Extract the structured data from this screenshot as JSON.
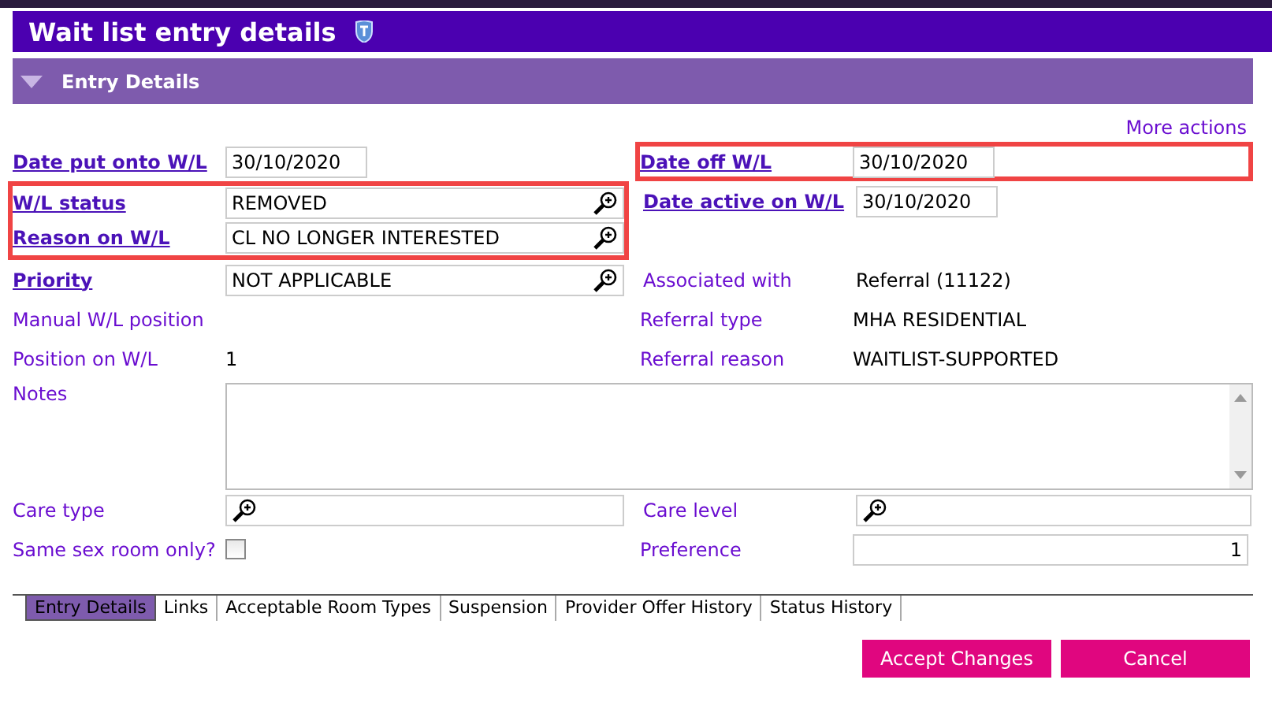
{
  "window": {
    "title": "Wait list entry details"
  },
  "section": {
    "title": "Entry Details",
    "expanded": true
  },
  "more_actions": "More actions",
  "rows": [
    {
      "left": {
        "label": "Date put onto W/L",
        "link": true,
        "kind": "text",
        "value": "30/10/2020",
        "highlighted": false
      },
      "right": {
        "label": "Date off W/L",
        "link": true,
        "kind": "text",
        "value": "30/10/2020",
        "highlighted": true
      }
    },
    {
      "left": {
        "label": "W/L status",
        "link": true,
        "kind": "lookup",
        "value": "REMOVED",
        "highlighted": true
      },
      "right": {
        "label": "Date active on W/L",
        "link": true,
        "kind": "text",
        "value": "30/10/2020",
        "highlighted": false
      }
    },
    {
      "left": {
        "label": "Reason on W/L",
        "link": true,
        "kind": "lookup",
        "value": "CL NO LONGER INTERESTED",
        "highlighted": true
      }
    },
    {
      "left": {
        "label": "Priority",
        "link": true,
        "kind": "lookup",
        "value": "NOT APPLICABLE",
        "highlighted": false
      },
      "right": {
        "label": "Associated with",
        "link": false,
        "kind": "value",
        "value": "Referral (11122)",
        "highlighted": false
      }
    },
    {
      "left": {
        "label": "Manual W/L position",
        "link": false,
        "kind": "value",
        "highlighted": false
      },
      "right": {
        "label": "Referral type",
        "link": false,
        "kind": "value",
        "value": "MHA RESIDENTIAL",
        "highlighted": false
      }
    },
    {
      "left": {
        "label": "Position on W/L",
        "link": false,
        "kind": "value",
        "value": "1",
        "highlighted": false
      },
      "right": {
        "label": "Referral reason",
        "link": false,
        "kind": "value",
        "value": "WAITLIST-SUPPORTED",
        "highlighted": false
      }
    }
  ],
  "notes": {
    "label": "Notes"
  },
  "lower_rows": [
    {
      "left": {
        "label": "Care type",
        "kind": "lookup"
      },
      "right": {
        "label": "Care level",
        "kind": "lookup"
      }
    },
    {
      "left": {
        "label": "Same sex room only?",
        "kind": "checkbox",
        "checked": false
      },
      "right": {
        "label": "Preference",
        "kind": "number",
        "value": "1"
      }
    }
  ],
  "tabs": [
    {
      "label": "Entry Details",
      "selected": true
    },
    {
      "label": "Links",
      "selected": false
    },
    {
      "label": "Acceptable Room Types",
      "selected": false
    },
    {
      "label": "Suspension",
      "selected": false
    },
    {
      "label": "Provider Offer History",
      "selected": false
    },
    {
      "label": "Status History",
      "selected": false
    }
  ],
  "buttons": [
    "Accept Changes",
    "Cancel"
  ]
}
